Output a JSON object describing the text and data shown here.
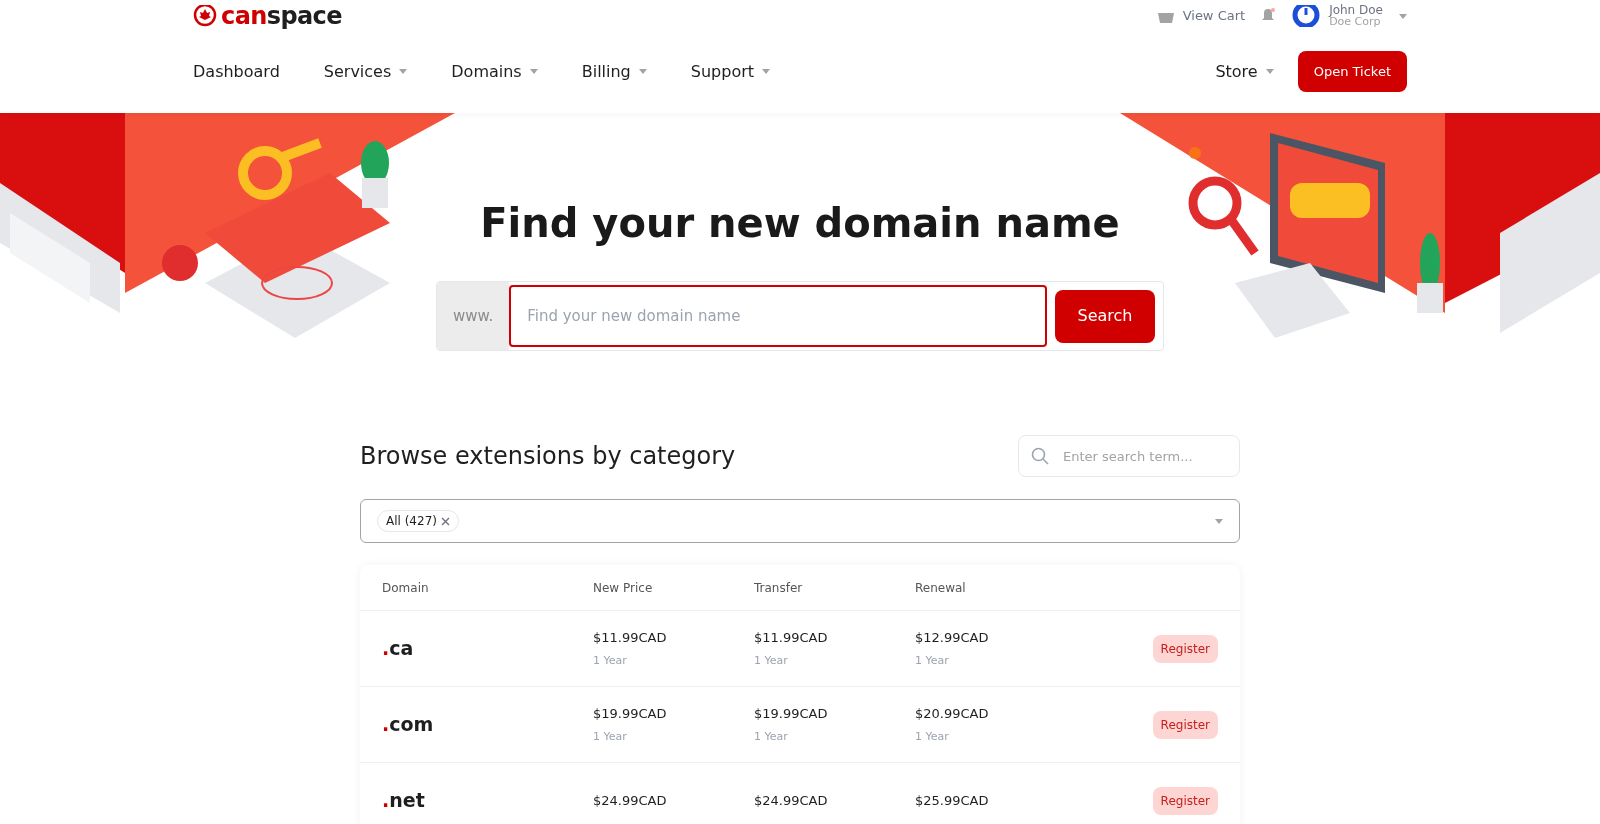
{
  "header": {
    "logo": {
      "part_1": "can",
      "part_2": "space"
    },
    "top_links": {
      "cart": "View Cart",
      "user_name": "John Doe",
      "company": "Doe Corp"
    },
    "nav": [
      {
        "label": "Dashboard",
        "dropdown": false
      },
      {
        "label": "Services",
        "dropdown": true
      },
      {
        "label": "Domains",
        "dropdown": true
      },
      {
        "label": "Billing",
        "dropdown": true
      },
      {
        "label": "Support",
        "dropdown": true
      }
    ],
    "store": {
      "label": "Store",
      "dropdown": true
    },
    "open_ticket": "Open Ticket"
  },
  "hero": {
    "title": "Find your new domain name",
    "prefix": "www.",
    "placeholder": "Find your new domain name",
    "button": "Search"
  },
  "browse": {
    "title": "Browse extensions by category",
    "search_placeholder": "Enter search term...",
    "filter_tags": [
      "All (427)"
    ]
  },
  "table": {
    "columns": [
      "Domain",
      "New Price",
      "Transfer",
      "Renewal"
    ],
    "rows": [
      {
        "tld": ".ca",
        "prices": [
          {
            "price": "$11.99CAD",
            "term": "1 Year"
          },
          {
            "price": "$11.99CAD",
            "term": "1 Year"
          },
          {
            "price": "$12.99CAD",
            "term": "1 Year"
          }
        ],
        "action": "Register"
      },
      {
        "tld": ".com",
        "prices": [
          {
            "price": "$19.99CAD",
            "term": "1 Year"
          },
          {
            "price": "$19.99CAD",
            "term": "1 Year"
          },
          {
            "price": "$20.99CAD",
            "term": "1 Year"
          }
        ],
        "action": "Register"
      },
      {
        "tld": ".net",
        "prices": [
          {
            "price": "$24.99CAD"
          },
          {
            "price": "$24.99CAD"
          },
          {
            "price": "$25.99CAD"
          }
        ],
        "action": "Register"
      }
    ]
  }
}
